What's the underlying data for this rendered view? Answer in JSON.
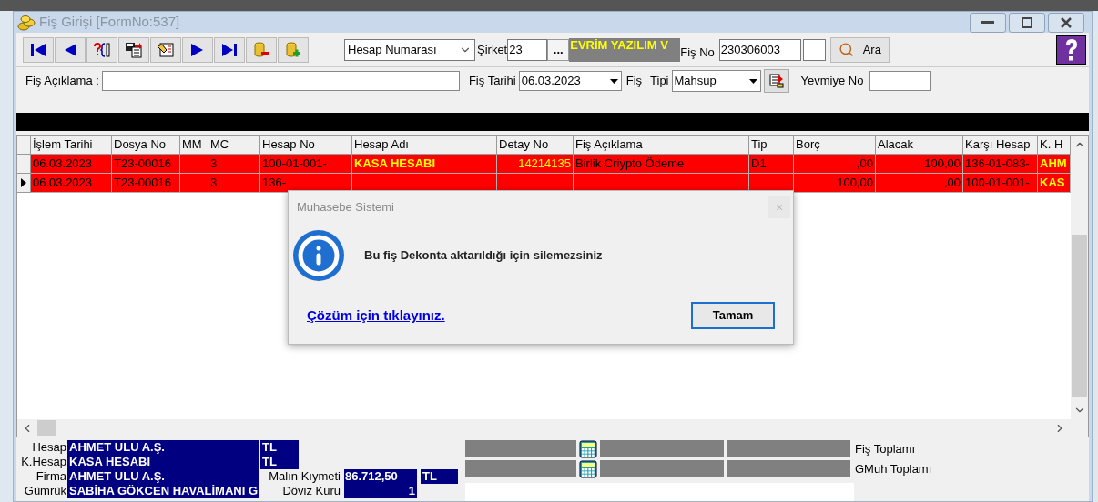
{
  "window": {
    "title": "Fiş Girişi [FormNo:537]"
  },
  "toolbar": [
    {
      "kind": "first"
    },
    {
      "kind": "prev"
    },
    {
      "kind": "query"
    },
    {
      "kind": "save"
    },
    {
      "kind": "edit"
    },
    {
      "kind": "next"
    },
    {
      "kind": "last"
    },
    {
      "kind": "delete"
    },
    {
      "kind": "add"
    }
  ],
  "search_by": {
    "value": "Hesap Numarası"
  },
  "company": {
    "label": "Şirket",
    "value": "23",
    "browse": "...",
    "name": "EVRİM YAZILIM  V"
  },
  "voucher_no": {
    "label": "Fiş No",
    "value": "230306003"
  },
  "search_button": "Ara",
  "description": {
    "label": "Fiş Açıklama :"
  },
  "date": {
    "label": "Fiş Tarihi",
    "value": "06.03.2023"
  },
  "voucher_type": {
    "label_1": "Fiş",
    "label_2": "Tipi",
    "value": "Mahsup"
  },
  "journal_no": {
    "label": "Yevmiye No"
  },
  "table": {
    "columns": [
      {
        "title": "İşlem Tarihi",
        "kind": "text"
      },
      {
        "title": "Dosya No",
        "kind": "text"
      },
      {
        "title": "MM",
        "kind": "text"
      },
      {
        "title": "MC",
        "kind": "text"
      },
      {
        "title": "Hesap No",
        "kind": "text"
      },
      {
        "title": "Hesap Adı",
        "kind": "name"
      },
      {
        "title": "Detay No",
        "kind": "code"
      },
      {
        "title": "Fiş Açıklama",
        "kind": "text"
      },
      {
        "title": "Tip",
        "kind": "text"
      },
      {
        "title": "Borç",
        "kind": "number"
      },
      {
        "title": "Alacak",
        "kind": "number"
      },
      {
        "title": "Karşı Hesap",
        "kind": "text"
      },
      {
        "title": "K. H",
        "kind": "name"
      }
    ],
    "rows": [
      {
        "selected": false,
        "cells": [
          "06.03.2023",
          "T23-00016",
          null,
          "3",
          "100-01-001-",
          "KASA HESABI",
          "14214135",
          "Birlik Criypto Ödeme",
          "D1",
          ",00",
          "100,00",
          "136-01-083-",
          "AHM"
        ]
      },
      {
        "selected": true,
        "cells": [
          "06.03.2023",
          "T23-00016",
          null,
          "3",
          "136-",
          null,
          null,
          null,
          null,
          "100,00",
          ",00",
          "100-01-001-",
          "KAS"
        ]
      }
    ]
  },
  "dialog": {
    "title": "Muhasebe Sistemi",
    "close": "×",
    "message": "Bu fiş Dekonta aktarıldığı için silemezsiniz",
    "link": "Çözüm için tıklayınız.",
    "button": "Tamam"
  },
  "summary": {
    "rows": [
      {
        "label": "Hesap",
        "value": "AHMET ULU A.Ş.",
        "currency": "TL"
      },
      {
        "label": "K.Hesap",
        "value": "KASA HESABI",
        "currency": "TL"
      },
      {
        "label": "Firma",
        "value": "AHMET ULU A.Ş.",
        "extra_label": "Malın Kıymeti",
        "extra_value": "86.712,50",
        "extra_currency": "TL"
      },
      {
        "label": "Gümrük",
        "value": "SABİHA GÖKCEN HAVALİMANI G",
        "extra_label": "Döviz Kuru",
        "extra_value": "1"
      }
    ],
    "totals": [
      {
        "label": "Fiş Toplamı"
      },
      {
        "label": "GMuh Toplamı"
      }
    ]
  }
}
